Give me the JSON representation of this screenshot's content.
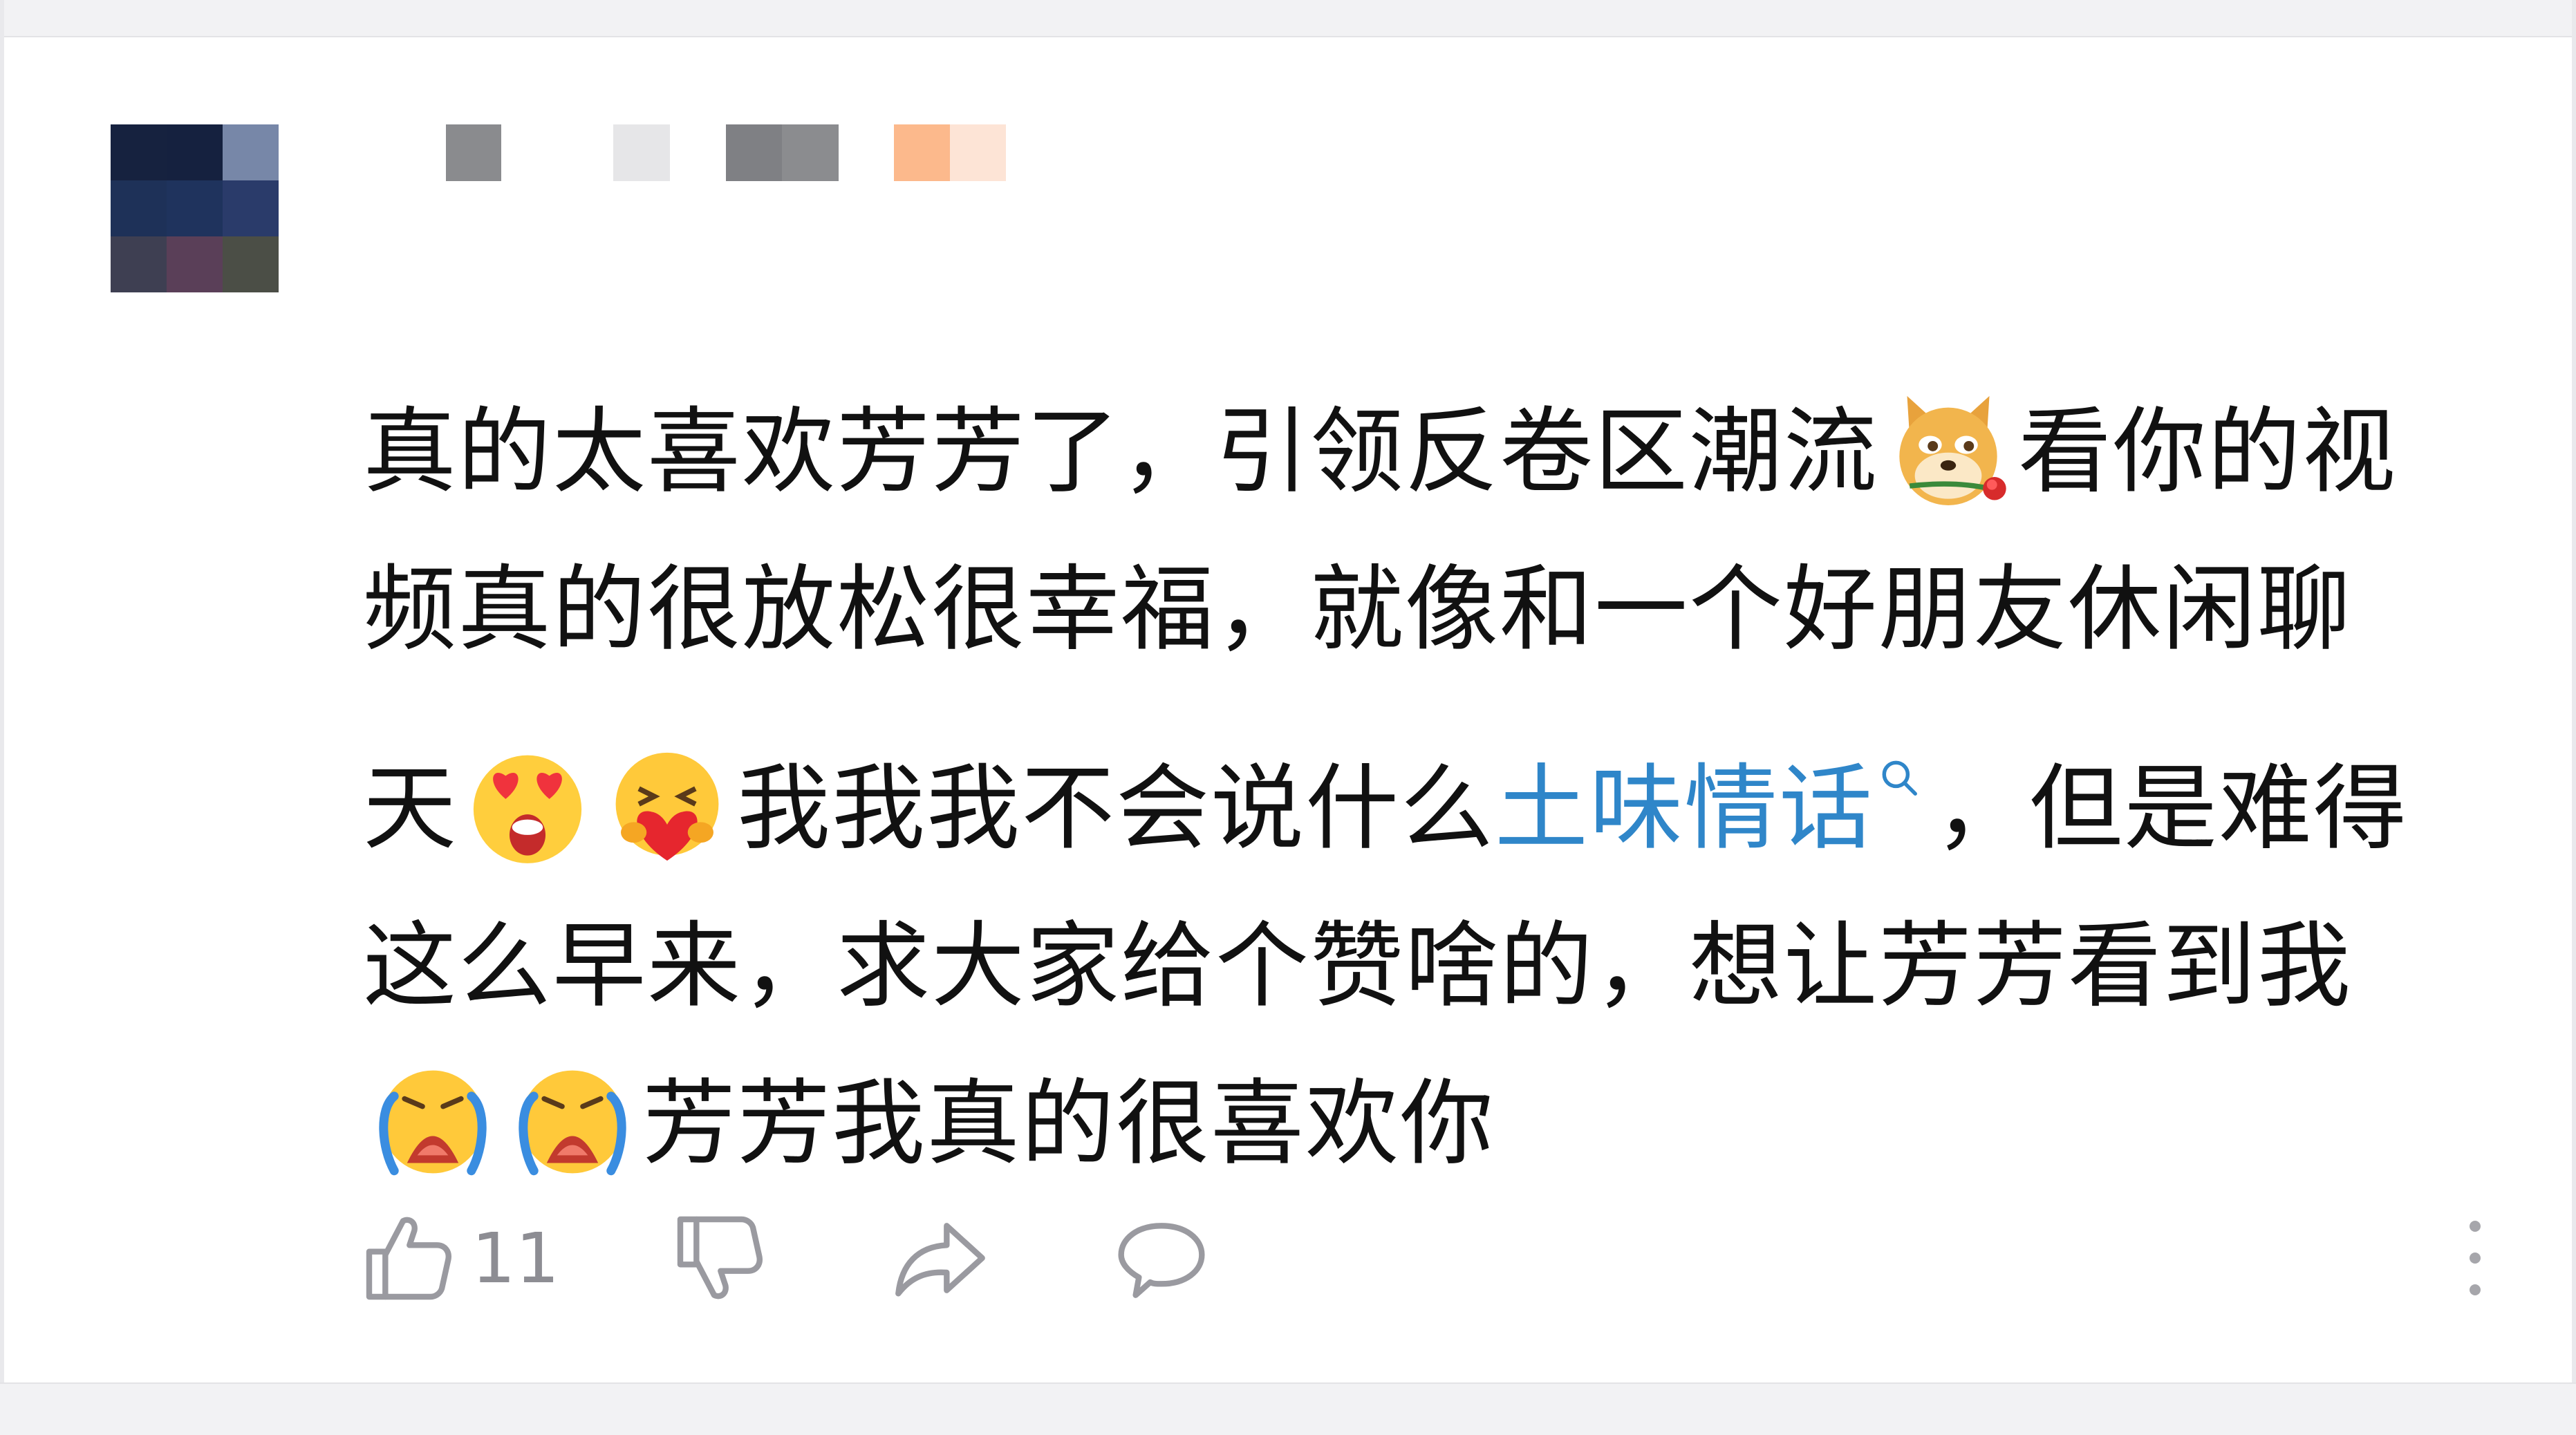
{
  "comment": {
    "segments": [
      {
        "type": "text",
        "value": "真的太喜欢芳芳了，引领反卷区潮流"
      },
      {
        "type": "emoji",
        "name": "doge-with-rose-emoji"
      },
      {
        "type": "text",
        "value": "看你的视频真的很放松很幸福，就像和一个好朋友休闲聊天"
      },
      {
        "type": "emoji",
        "name": "heart-eyes-emoji"
      },
      {
        "type": "emoji",
        "name": "hug-heart-emoji"
      },
      {
        "type": "text",
        "value": "我我我不会说什么"
      },
      {
        "type": "link",
        "value": "土味情话"
      },
      {
        "type": "text",
        "value": "，但是难得这么早来，求大家给个赞啥的，想让芳芳看到我"
      },
      {
        "type": "emoji",
        "name": "crying-emoji"
      },
      {
        "type": "emoji",
        "name": "crying-emoji"
      },
      {
        "type": "text",
        "value": "芳芳我真的很喜欢你"
      }
    ]
  },
  "actions": {
    "like_count": "11",
    "icons": [
      "thumbs-up-icon",
      "thumbs-down-icon",
      "share-icon",
      "comment-icon",
      "more-vertical-icon"
    ]
  },
  "colors": {
    "text": "#111111",
    "link": "#2f86c9",
    "icon": "#9a9aa0",
    "frame": "#f2f2f4"
  }
}
